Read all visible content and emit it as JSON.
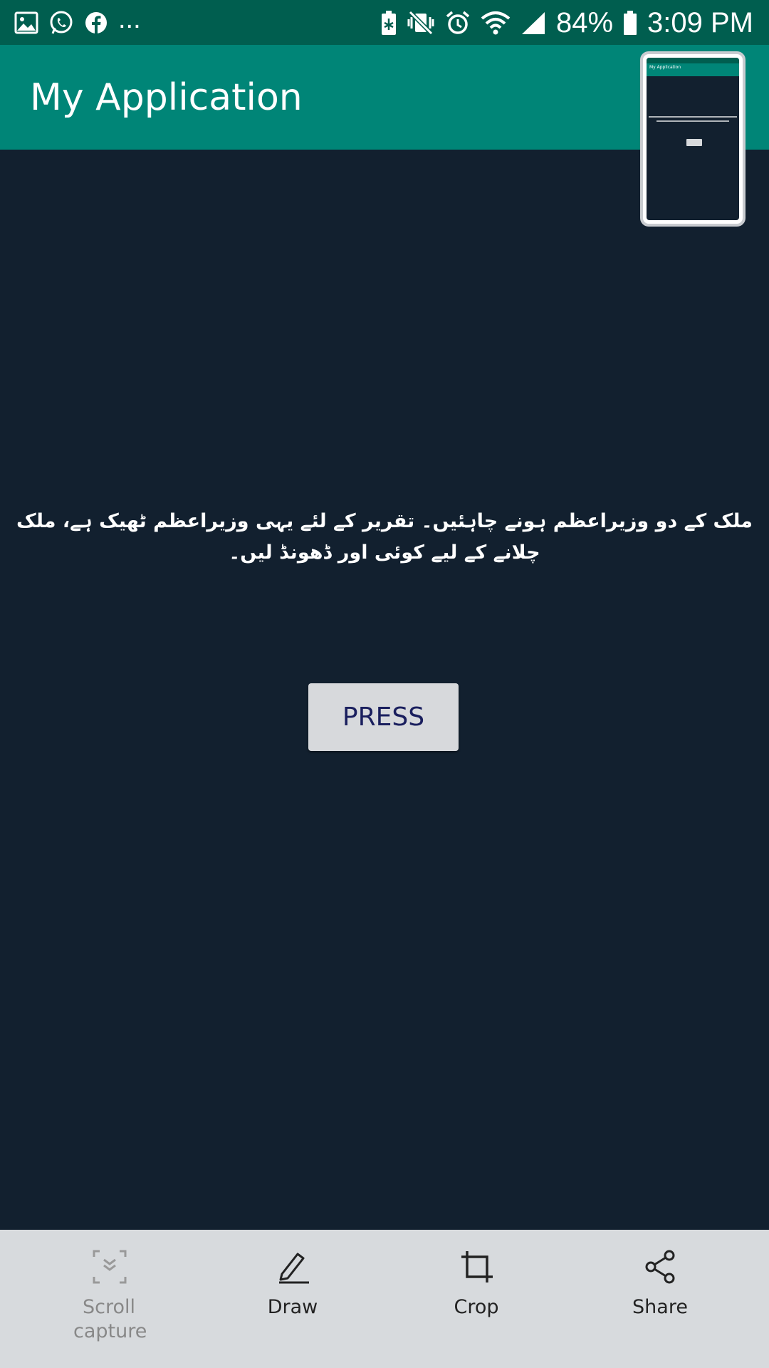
{
  "status_bar": {
    "notification_icons": [
      "gallery-icon",
      "whatsapp-icon",
      "facebook-icon"
    ],
    "overflow": "...",
    "system_icons": [
      "battery-saver-icon",
      "vibrate-mute-icon",
      "alarm-icon",
      "wifi-icon",
      "cell-signal-icon"
    ],
    "battery": "84%",
    "time": "3:09 PM"
  },
  "app_bar": {
    "title": "My Application"
  },
  "thumbnail": {
    "title": "My Application",
    "button": "PRESS"
  },
  "main": {
    "message": "ملک کے دو وزیراعظم ہونے چاہئیں۔ تقریر کے لئے یہی وزیراعظم ٹھیک ہے، ملک چلانے کے لیے کوئی اور ڈھونڈ لیں۔",
    "button_label": "PRESS"
  },
  "bottom_bar": {
    "scroll_capture": "Scroll capture",
    "draw": "Draw",
    "crop": "Crop",
    "share": "Share"
  },
  "colors": {
    "status_bar": "#005e4f",
    "app_bar": "#008577",
    "background": "#12202f",
    "button": "#d7d9dc",
    "button_text": "#1a1f5e",
    "toolbar": "#d7dadd"
  }
}
